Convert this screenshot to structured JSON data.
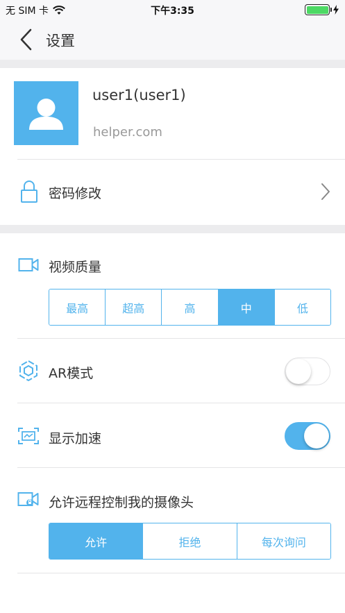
{
  "status_bar": {
    "carrier": "无 SIM 卡",
    "time": "下午3:35"
  },
  "nav": {
    "title": "设置"
  },
  "profile": {
    "username": "user1(user1)",
    "domain": "helper.com"
  },
  "password_row": {
    "label": "密码修改"
  },
  "video_quality": {
    "label": "视频质量",
    "options": [
      "最高",
      "超高",
      "高",
      "中",
      "低"
    ],
    "selected": "中"
  },
  "ar_mode": {
    "label": "AR模式",
    "enabled": false
  },
  "display_accel": {
    "label": "显示加速",
    "enabled": true
  },
  "remote_camera": {
    "label": "允许远程控制我的摄像头",
    "options": [
      "允许",
      "拒绝",
      "每次询问"
    ],
    "selected": "允许"
  },
  "colors": {
    "accent": "#52b3ec",
    "toggle_on": "#52b3ec",
    "battery": "#4cd964"
  }
}
